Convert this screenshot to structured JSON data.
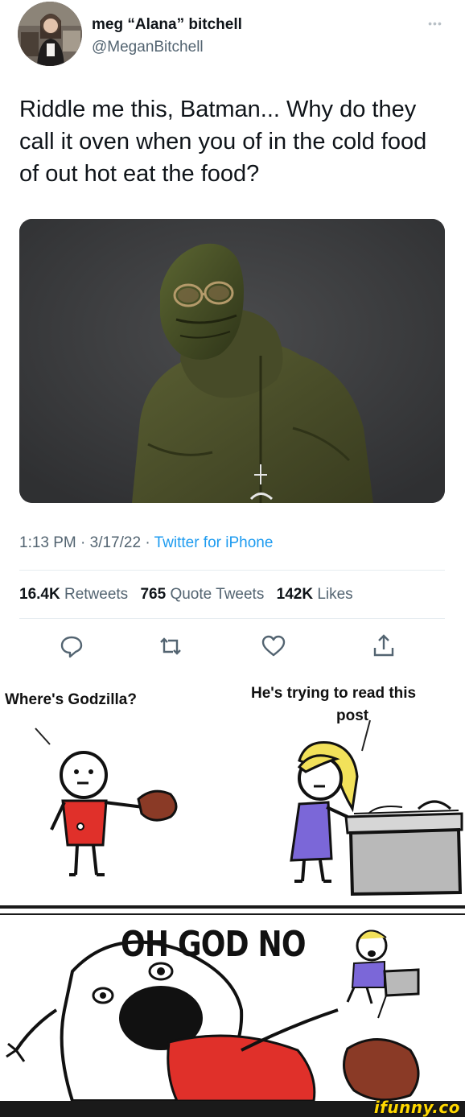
{
  "tweet": {
    "author": {
      "name": "meg “Alana” bitchell",
      "handle": "@MeganBitchell"
    },
    "text": "Riddle me this, Batman... Why do they call it oven when you of in the cold food of out hot eat the food?",
    "meta": {
      "time_date": "1:13 PM · 3/17/22 · ",
      "source": "Twitter for iPhone"
    },
    "stats": {
      "retweets_count": "16.4K",
      "retweets_label": "Retweets",
      "quote_count": "765",
      "quote_label": "Quote Tweets",
      "likes_count": "142K",
      "likes_label": "Likes"
    },
    "actions": [
      "reply-icon",
      "retweet-icon",
      "like-icon",
      "share-icon"
    ]
  },
  "comic": {
    "left_speech": "Where's Godzilla?",
    "right_speech_line1": "He's trying to read this",
    "right_speech_line2": "post",
    "shout": "OH GOD NO"
  },
  "watermark": "ifunny.co",
  "colors": {
    "link": "#1d9bf0",
    "secondary_text": "#536471",
    "jacket": "#4b4f2a",
    "shirt_red": "#e0302a",
    "shirt_purple": "#7b67d8",
    "hair_yellow": "#f2e15a",
    "glove_brown": "#8a3a26",
    "counter_gray": "#b9b9b9"
  }
}
